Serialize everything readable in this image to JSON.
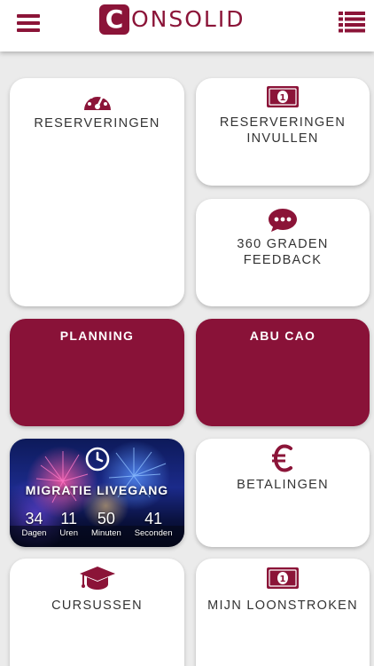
{
  "header": {
    "logo": {
      "letter": "C",
      "text": "ONSOLID"
    },
    "menu_icon": "hamburger-icon",
    "list_icon": "list-view-icon",
    "brand_color": "#8b1438"
  },
  "tiles": {
    "reserveringen": {
      "label": "RESERVERINGEN",
      "icon": "dashboard-gauge-icon"
    },
    "reserveringen_invullen": {
      "label_line1": "RESERVERINGEN",
      "label_line2": "INVULLEN",
      "icon": "banknote-icon"
    },
    "feedback": {
      "label": "360 GRADEN FEEDBACK",
      "icon": "chat-bubble-icon"
    },
    "planning": {
      "label": "PLANNING"
    },
    "abu_cao": {
      "label": "ABU CAO"
    },
    "betalingen": {
      "label": "BETALINGEN",
      "icon": "euro-icon"
    },
    "cursussen": {
      "label": "CURSUSSEN",
      "icon": "graduation-cap-icon"
    },
    "loonstroken": {
      "label": "MIJN LOONSTROKEN",
      "icon": "banknote-icon"
    }
  },
  "promo": {
    "title": "MIGRATIE LIVEGANG",
    "icon": "clock-icon",
    "countdown": [
      {
        "value": "34",
        "unit": "Dagen"
      },
      {
        "value": "11",
        "unit": "Uren"
      },
      {
        "value": "50",
        "unit": "Minuten"
      },
      {
        "value": "41",
        "unit": "Seconden"
      }
    ]
  },
  "colors": {
    "accent": "#891238",
    "tile_bg": "#ffffff",
    "page_bg": "#ebebeb"
  }
}
